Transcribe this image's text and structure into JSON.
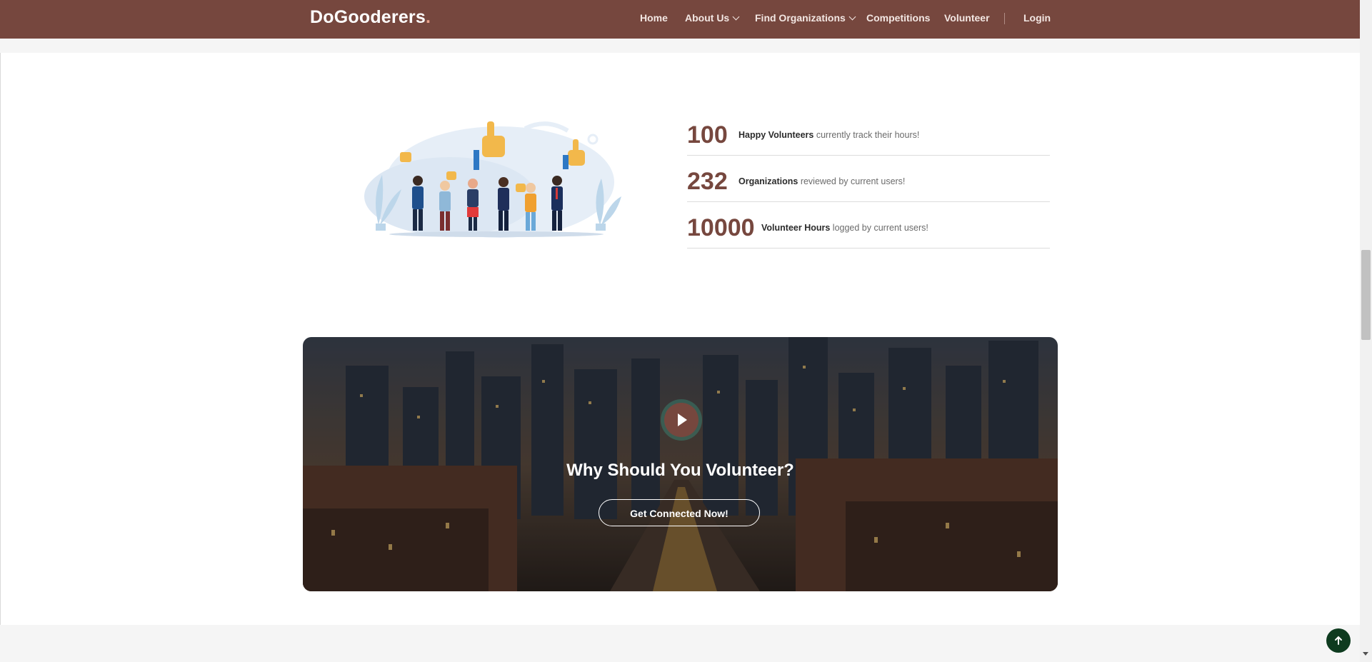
{
  "brand": {
    "name": "DoGooderers",
    "dot": ".",
    "color": "#76473e"
  },
  "nav": {
    "home": "Home",
    "about": "About Us",
    "find": "Find Organizations",
    "competitions": "Competitions",
    "volunteer": "Volunteer",
    "login": "Login"
  },
  "stats": [
    {
      "number": "100",
      "label": "Happy Volunteers",
      "text": " currently track their hours!"
    },
    {
      "number": "232",
      "label": "Organizations",
      "text": " reviewed by current users!"
    },
    {
      "number": "10000",
      "label": "Volunteer Hours",
      "text": " logged by current users!"
    }
  ],
  "banner": {
    "title": "Why Should You Volunteer?",
    "cta": "Get Connected Now!"
  },
  "icons": {
    "play": "play-icon",
    "chevron": "chevron-down-icon",
    "back_to_top": "arrow-up-icon"
  }
}
